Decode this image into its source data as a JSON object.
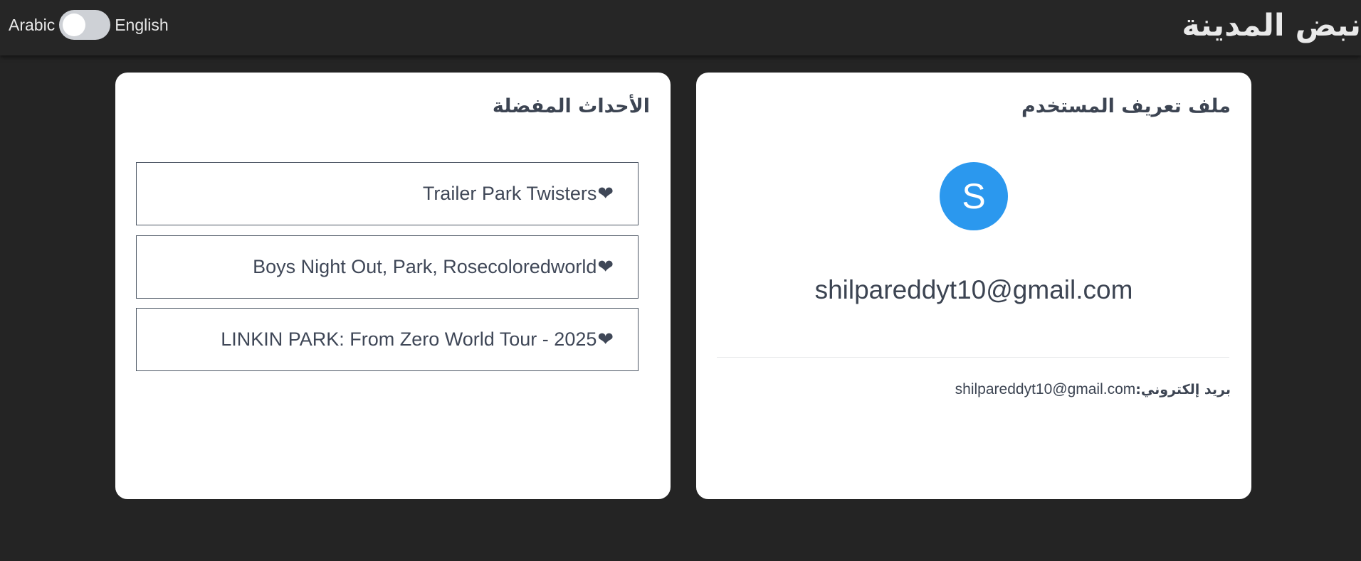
{
  "header": {
    "brand": "نبض المدينة",
    "lang_left": "Arabic",
    "lang_right": "English",
    "toggle_state": "arabic"
  },
  "favorites": {
    "title": "الأحداث المفضلة",
    "heart_icon": "heart-icon",
    "items": [
      {
        "label": "Trailer Park Twisters"
      },
      {
        "label": "Boys Night Out, Park, Rosecoloredworld"
      },
      {
        "label": "LINKIN PARK: From Zero World Tour - 2025"
      }
    ]
  },
  "profile": {
    "title": "ملف تعريف المستخدم",
    "avatar_initial": "S",
    "avatar_color": "#2b98ee",
    "email": "shilpareddyt10@gmail.com",
    "email_label": "بريد إلكتروني:",
    "email_value": "shilpareddyt10@gmail.com"
  }
}
